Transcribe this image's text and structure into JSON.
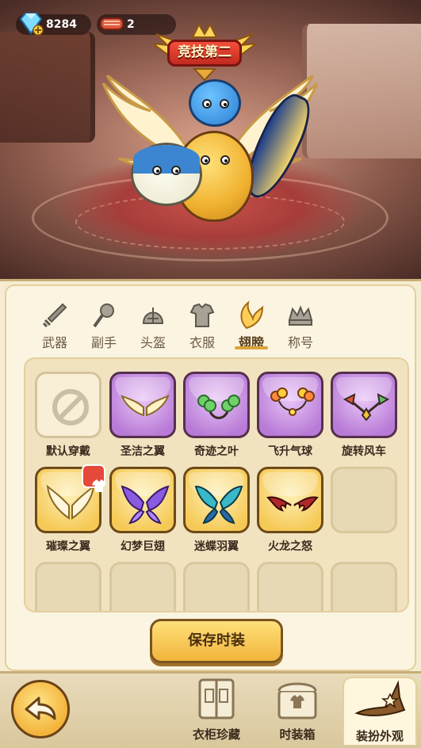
{
  "resources": {
    "gems": "8284",
    "meat": "2"
  },
  "rank_badge": "竞技第二",
  "tabs": [
    {
      "label": "武器",
      "icon": "sword-icon"
    },
    {
      "label": "副手",
      "icon": "offhand-icon"
    },
    {
      "label": "头盔",
      "icon": "helmet-icon"
    },
    {
      "label": "衣服",
      "icon": "armor-icon"
    },
    {
      "label": "翅膀",
      "icon": "wing-icon",
      "active": true
    },
    {
      "label": "称号",
      "icon": "title-icon"
    }
  ],
  "items": [
    {
      "label": "默认穿戴",
      "style": "plain",
      "icon": "no-entry-icon"
    },
    {
      "label": "圣洁之翼",
      "style": "purple",
      "icon": "holy-wings-icon"
    },
    {
      "label": "奇迹之叶",
      "style": "purple",
      "icon": "clover-wings-icon"
    },
    {
      "label": "飞升气球",
      "style": "purple",
      "icon": "balloon-wings-icon"
    },
    {
      "label": "旋转风车",
      "style": "purple",
      "icon": "pinwheel-wings-icon"
    },
    {
      "label": "璀璨之翼",
      "style": "gold",
      "icon": "radiant-wings-icon",
      "equipped": true
    },
    {
      "label": "幻梦巨翅",
      "style": "gold",
      "icon": "dream-wings-icon"
    },
    {
      "label": "迷蝶羽翼",
      "style": "gold",
      "icon": "butterfly-wings-icon"
    },
    {
      "label": "火龙之怒",
      "style": "gold",
      "icon": "dragon-wings-icon"
    }
  ],
  "save_button": "保存时装",
  "bottom_nav": [
    {
      "label": "衣柜珍藏",
      "icon": "wardrobe-book-icon"
    },
    {
      "label": "时装箱",
      "icon": "fashion-box-icon"
    },
    {
      "label": "装扮外观",
      "icon": "witch-hat-icon",
      "active": true
    }
  ],
  "colors": {
    "accent_gold": "#f1b43c",
    "rare_purple": "#b87ad6",
    "panel_bg": "#fbf4e0"
  }
}
